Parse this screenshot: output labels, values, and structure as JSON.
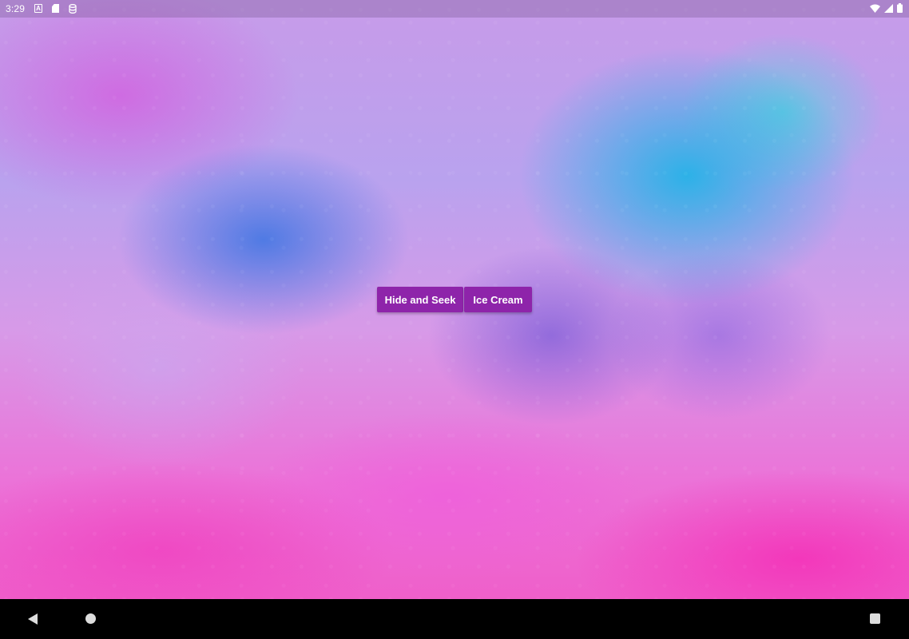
{
  "status_bar": {
    "time": "3:29",
    "icon_a_label": "A",
    "icons": [
      "a-notification-icon",
      "sd-card-icon",
      "database-icon",
      "wifi-icon",
      "cell-signal-icon",
      "battery-icon"
    ]
  },
  "main": {
    "buttons": [
      {
        "label": "Hide and Seek"
      },
      {
        "label": "Ice Cream"
      }
    ],
    "button_color": "#8e24aa"
  },
  "nav_bar": {
    "icons": [
      "back-icon",
      "home-icon",
      "recents-icon"
    ]
  }
}
